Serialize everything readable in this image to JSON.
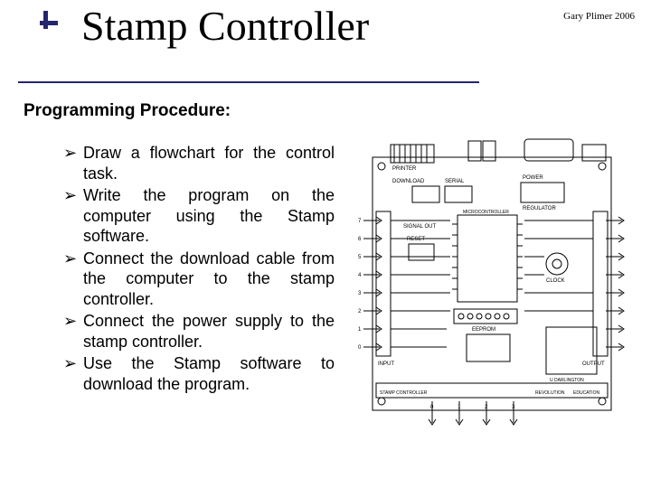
{
  "header": {
    "title": "Stamp Controller",
    "attribution": "Gary Plimer 2006"
  },
  "body": {
    "subheading": "Programming Procedure:",
    "bullet_glyph": "➢",
    "bullets": [
      "Draw a flowchart for the control  task.",
      "Write the program on the  computer using the Stamp  software.",
      "Connect the download cable from the computer to the stamp controller.",
      "Connect the power supply  to the stamp controller.",
      "Use the Stamp software to  download the program."
    ]
  },
  "figure": {
    "labels": {
      "board_title": "STAMP CONTROLLER",
      "printer": "PRINTER",
      "download": "DOWNLOAD",
      "serial": "SERIAL",
      "signal_out": "SIGNAL OUT",
      "reset": "RESET",
      "input_header": "INPUT",
      "output_header": "OUTPUT",
      "power": "POWER",
      "regulator": "REGULATOR",
      "micro": "MICROCONTROLLER",
      "clock": "CLOCK",
      "eeprom": "EEPROM",
      "u_darlington": "U DARLINGTON",
      "brand_a": "REVOLUTION",
      "brand_b": "EDUCATION",
      "pins_left": [
        "7",
        "6",
        "5",
        "4",
        "3",
        "2",
        "1",
        "0"
      ],
      "pins_bottom": [
        "0",
        "1",
        "2",
        "3"
      ]
    }
  }
}
